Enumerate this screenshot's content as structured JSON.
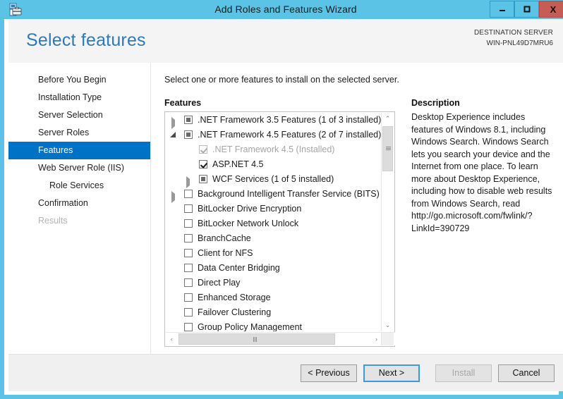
{
  "window": {
    "title": "Add Roles and Features Wizard",
    "app_icon": "server-wizard-icon",
    "controls": {
      "minimize": "–",
      "maximize": "❐",
      "close": "X"
    },
    "accent_color": "#5bc3e5",
    "selection_color": "#0072c6"
  },
  "header": {
    "page_title": "Select features",
    "destination_label": "DESTINATION SERVER",
    "destination_server": "WIN-PNL49D7MRU6"
  },
  "nav": {
    "items": [
      {
        "label": "Before You Begin",
        "state": "normal",
        "indent": 0
      },
      {
        "label": "Installation Type",
        "state": "normal",
        "indent": 0
      },
      {
        "label": "Server Selection",
        "state": "normal",
        "indent": 0
      },
      {
        "label": "Server Roles",
        "state": "normal",
        "indent": 0
      },
      {
        "label": "Features",
        "state": "selected",
        "indent": 0
      },
      {
        "label": "Web Server Role (IIS)",
        "state": "normal",
        "indent": 0
      },
      {
        "label": "Role Services",
        "state": "normal",
        "indent": 1
      },
      {
        "label": "Confirmation",
        "state": "normal",
        "indent": 0
      },
      {
        "label": "Results",
        "state": "disabled",
        "indent": 0
      }
    ]
  },
  "main": {
    "instruction": "Select one or more features to install on the selected server.",
    "features_label": "Features",
    "description_label": "Description",
    "description_text": "Desktop Experience includes features of Windows 8.1, including Windows Search. Windows Search lets you search your device and the Internet from one place. To learn more about Desktop Experience, including how to disable web results from Windows Search, read http://go.microsoft.com/fwlink/?LinkId=390729",
    "features": [
      {
        "label": ".NET Framework 3.5 Features (1 of 3 installed)",
        "check": "partial",
        "twisty": "collapsed",
        "indent": 1,
        "dim": false
      },
      {
        "label": ".NET Framework 4.5 Features (2 of 7 installed)",
        "check": "partial",
        "twisty": "expanded",
        "indent": 1,
        "dim": false
      },
      {
        "label": ".NET Framework 4.5 (Installed)",
        "check": "installed",
        "twisty": "none",
        "indent": 2,
        "dim": true
      },
      {
        "label": "ASP.NET 4.5",
        "check": "checked",
        "twisty": "none",
        "indent": 2,
        "dim": false
      },
      {
        "label": "WCF Services (1 of 5 installed)",
        "check": "partial",
        "twisty": "collapsed",
        "indent": 2,
        "dim": false
      },
      {
        "label": "Background Intelligent Transfer Service (BITS)",
        "check": "unchecked",
        "twisty": "collapsed",
        "indent": 1,
        "dim": false
      },
      {
        "label": "BitLocker Drive Encryption",
        "check": "unchecked",
        "twisty": "none",
        "indent": 1,
        "dim": false
      },
      {
        "label": "BitLocker Network Unlock",
        "check": "unchecked",
        "twisty": "none",
        "indent": 1,
        "dim": false
      },
      {
        "label": "BranchCache",
        "check": "unchecked",
        "twisty": "none",
        "indent": 1,
        "dim": false
      },
      {
        "label": "Client for NFS",
        "check": "unchecked",
        "twisty": "none",
        "indent": 1,
        "dim": false
      },
      {
        "label": "Data Center Bridging",
        "check": "unchecked",
        "twisty": "none",
        "indent": 1,
        "dim": false
      },
      {
        "label": "Direct Play",
        "check": "unchecked",
        "twisty": "none",
        "indent": 1,
        "dim": false
      },
      {
        "label": "Enhanced Storage",
        "check": "unchecked",
        "twisty": "none",
        "indent": 1,
        "dim": false
      },
      {
        "label": "Failover Clustering",
        "check": "unchecked",
        "twisty": "none",
        "indent": 1,
        "dim": false
      },
      {
        "label": "Group Policy Management",
        "check": "unchecked",
        "twisty": "none",
        "indent": 1,
        "dim": false
      }
    ],
    "scroll": {
      "up_arrow": "⌃",
      "down_arrow": "⌄",
      "left_arrow": "‹",
      "right_arrow": "›"
    }
  },
  "footer": {
    "previous": "< Previous",
    "next": "Next >",
    "install": "Install",
    "cancel": "Cancel"
  }
}
